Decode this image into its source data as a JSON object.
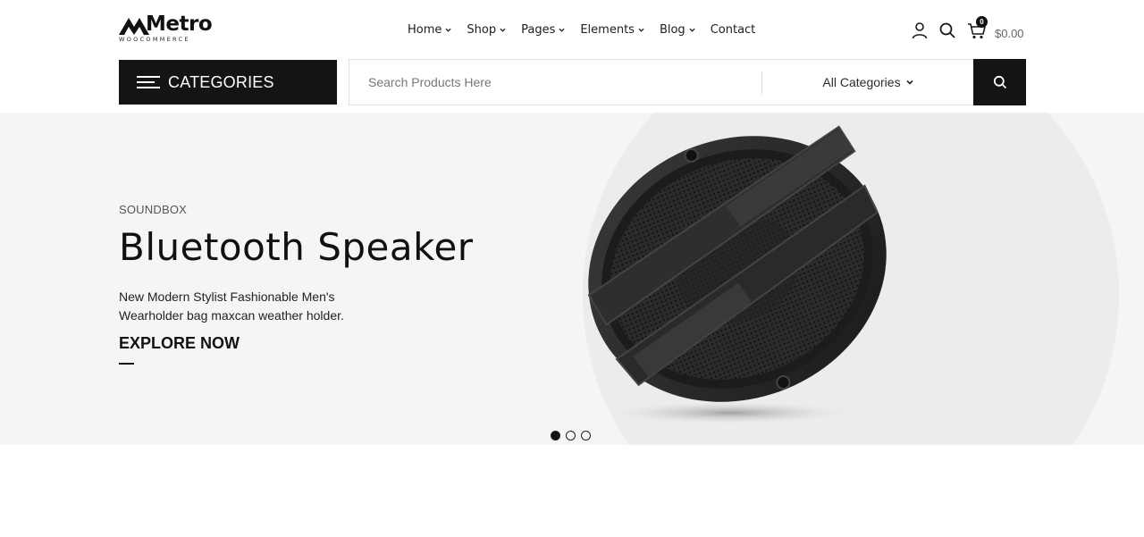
{
  "brand": {
    "name": "Metro",
    "tagline": "WOOCOMMERCE"
  },
  "nav": {
    "items": [
      {
        "label": "Home",
        "has_dropdown": true
      },
      {
        "label": "Shop",
        "has_dropdown": true
      },
      {
        "label": "Pages",
        "has_dropdown": true
      },
      {
        "label": "Elements",
        "has_dropdown": true
      },
      {
        "label": "Blog",
        "has_dropdown": true
      },
      {
        "label": "Contact",
        "has_dropdown": false
      }
    ]
  },
  "header": {
    "icons": [
      "user-icon",
      "search-icon",
      "cart-icon"
    ],
    "cart_count": "0",
    "cart_total": "$0.00"
  },
  "categories": {
    "label": "CATEGORIES"
  },
  "search": {
    "placeholder": "Search Products Here",
    "value": "",
    "category_selected": "All Categories"
  },
  "hero": {
    "subtitle": "SOUNDBOX",
    "title": "Bluetooth Speaker",
    "description": "New Modern Stylist Fashionable Men's Wearholder bag maxcan weather holder.",
    "cta": "EXPLORE NOW",
    "slide_count": 3,
    "active_slide": 1
  },
  "colors": {
    "primary": "#141414",
    "hero_bg": "#f5f5f5",
    "hero_circle": "#ececec",
    "text": "#1b1b1b"
  }
}
